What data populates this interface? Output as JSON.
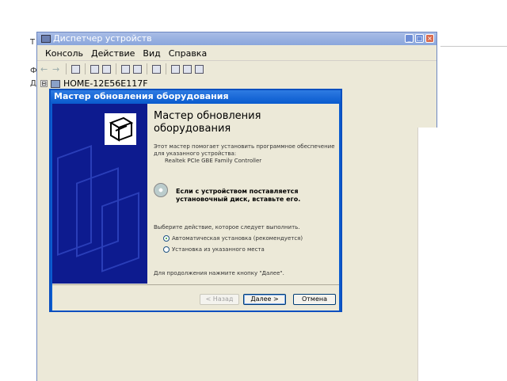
{
  "background": {
    "fragment_top": "Т",
    "fragment_mid": "Ф",
    "fragment_low": "Д"
  },
  "device_manager": {
    "title": "Диспетчер устройств",
    "title_buttons": [
      "_",
      "□",
      "×"
    ],
    "menu": [
      "Консоль",
      "Действие",
      "Вид",
      "Справка"
    ],
    "tree_toggle": "⊟",
    "tree_root": "HOME-12E56E117F"
  },
  "wizard": {
    "title": "Мастер обновления оборудования",
    "heading": "Мастер обновления оборудования",
    "description": "Этот мастер помогает установить программное обеспечение для указанного устройства:",
    "device_name": "Realtek PCIe GBE Family Controller",
    "cd_text": "Если с устройством поставляется установочный диск, вставьте его.",
    "choose_action": "Выберите действие, которое следует выполнить.",
    "options": [
      {
        "label": "Автоматическая установка (рекомендуется)",
        "checked": true
      },
      {
        "label": "Установка из указанного места",
        "checked": false
      }
    ],
    "continue_hint": "Для продолжения нажмите кнопку \"Далее\".",
    "buttons": {
      "back": "< Назад",
      "next": "Далее >",
      "cancel": "Отмена"
    }
  },
  "colors": {
    "xp_blue": "#0b5ccf",
    "banner_navy": "#0d1b8f",
    "dialog_face": "#ece9d8"
  },
  "icons": [
    "computer-icon",
    "hardware-wizard-icon",
    "cd-disc-icon",
    "back-arrow-icon",
    "forward-arrow-icon"
  ]
}
